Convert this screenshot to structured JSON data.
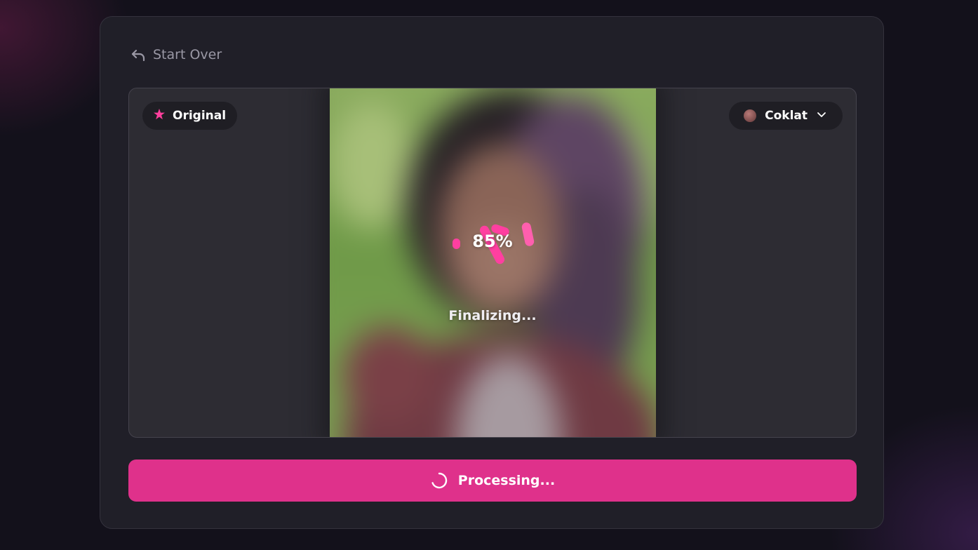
{
  "header": {
    "start_over_label": "Start Over"
  },
  "preview": {
    "original_label": "Original",
    "style_label": "Coklat",
    "progress_text": "85%",
    "progress_value": 0.85,
    "status_text": "Finalizing..."
  },
  "action": {
    "button_label": "Processing..."
  },
  "colors": {
    "accent": "#df318b",
    "spark": "#ff3fa0",
    "card_bg": "#201f28",
    "page_bg": "#13111b"
  },
  "icons": {
    "start_over": "undo-arrow-icon",
    "original": "sparkle-star-icon",
    "style": "color-swatch-icon",
    "dropdown": "chevron-down-icon",
    "button": "spinner-icon"
  }
}
